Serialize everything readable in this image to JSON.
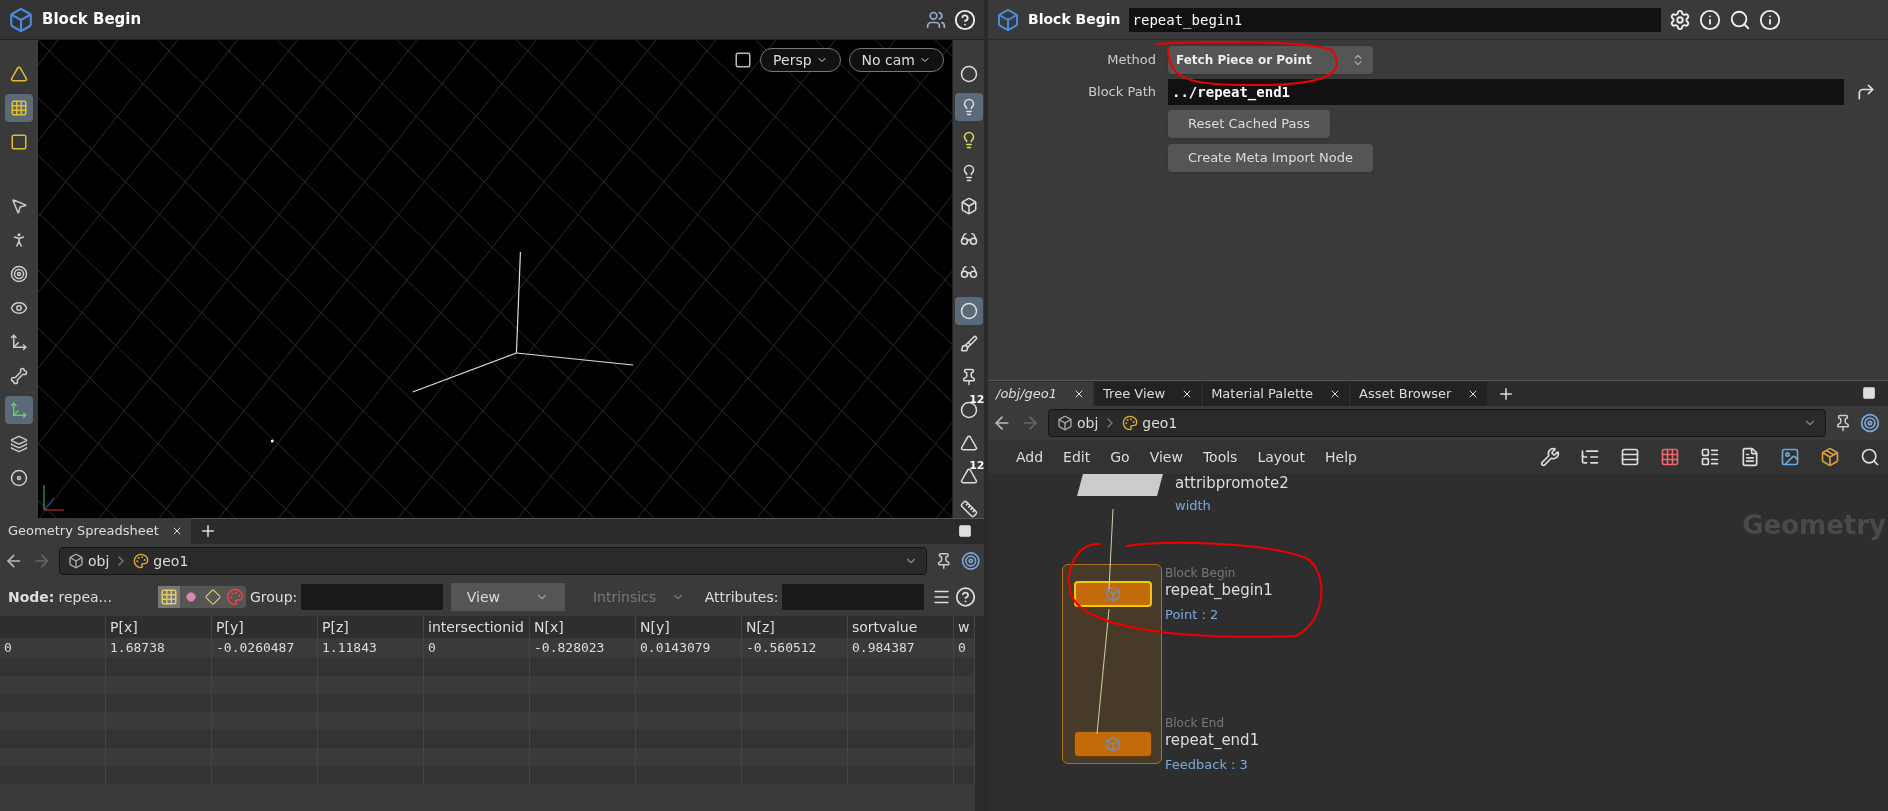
{
  "viewport_pane": {
    "title": "Block Begin",
    "camera_menus": [
      "Persp",
      "No cam"
    ],
    "left_tools": [
      {
        "kind": "cone",
        "selected": false
      },
      {
        "kind": "dots",
        "selected": true
      },
      {
        "kind": "square",
        "selected": false
      },
      {
        "kind": "arrow",
        "selected": false
      },
      {
        "kind": "pose",
        "selected": false
      },
      {
        "kind": "rig",
        "selected": false
      },
      {
        "kind": "view",
        "selected": false
      },
      {
        "kind": "joint",
        "selected": false
      },
      {
        "kind": "bones",
        "selected": false
      },
      {
        "kind": "handle",
        "selected": true
      },
      {
        "kind": "stack",
        "selected": false
      },
      {
        "kind": "disk",
        "selected": false
      }
    ],
    "right_tools": [
      {
        "kind": "sphere",
        "selected": false
      },
      {
        "kind": "bulb",
        "selected": true
      },
      {
        "kind": "bulb-plus",
        "selected": false
      },
      {
        "kind": "bulb-ground",
        "selected": false
      },
      {
        "kind": "cube",
        "selected": false
      },
      {
        "kind": "glasses",
        "selected": false
      },
      {
        "kind": "glasses-play",
        "selected": false
      },
      {
        "kind": "dot",
        "selected": true
      },
      {
        "kind": "brush",
        "selected": false
      },
      {
        "kind": "pin",
        "selected": false
      },
      {
        "kind": "number",
        "selected": false,
        "badge": "12"
      },
      {
        "kind": "shape",
        "selected": false
      },
      {
        "kind": "shape",
        "selected": false,
        "badge": "12"
      },
      {
        "kind": "ruler",
        "selected": false
      }
    ]
  },
  "spreadsheet": {
    "tabs": [
      {
        "label": "Geometry Spreadsheet",
        "selected": true
      }
    ],
    "path": [
      "obj",
      "geo1"
    ],
    "node_label": "Node:",
    "node_value": "repea...",
    "group_label": "Group:",
    "view_menu": "View",
    "intrinsics_menu": {
      "label": "Intrinsics",
      "disabled": true
    },
    "attributes_label": "Attributes:",
    "columns": [
      "",
      "P[x]",
      "P[y]",
      "P[z]",
      "intersectionid",
      "N[x]",
      "N[y]",
      "N[z]",
      "sortvalue",
      "w"
    ],
    "rows": [
      [
        "0",
        "1.68738",
        "-0.0260487",
        "1.11843",
        "0",
        "-0.828023",
        "0.0143079",
        "-0.560512",
        "0.984387",
        "0"
      ]
    ]
  },
  "parameters": {
    "node_type": "Block Begin",
    "node_name": "repeat_begin1",
    "method_label": "Method",
    "method_value": "Fetch Piece or Point",
    "block_path_label": "Block Path",
    "block_path_value": "../repeat_end1",
    "buttons": [
      "Reset Cached Pass",
      "Create Meta Import Node"
    ]
  },
  "network": {
    "tabs": [
      {
        "label": "/obj/geo1",
        "selected": true
      },
      {
        "label": "Tree View",
        "selected": false
      },
      {
        "label": "Material Palette",
        "selected": false
      },
      {
        "label": "Asset Browser",
        "selected": false
      }
    ],
    "path": [
      "obj",
      "geo1"
    ],
    "menu": [
      "Add",
      "Edit",
      "Go",
      "View",
      "Tools",
      "Layout",
      "Help"
    ],
    "context_label": "Geometry",
    "nodes": [
      {
        "kind": "attribpromote",
        "name": "attribpromote2",
        "comment": "width",
        "selected": false
      },
      {
        "kind": "block_begin",
        "type_label": "Block Begin",
        "name": "repeat_begin1",
        "comment": "Point : 2",
        "selected": true
      },
      {
        "kind": "block_end",
        "type_label": "Block End",
        "name": "repeat_end1",
        "comment": "Feedback : 3",
        "selected": false
      }
    ]
  }
}
